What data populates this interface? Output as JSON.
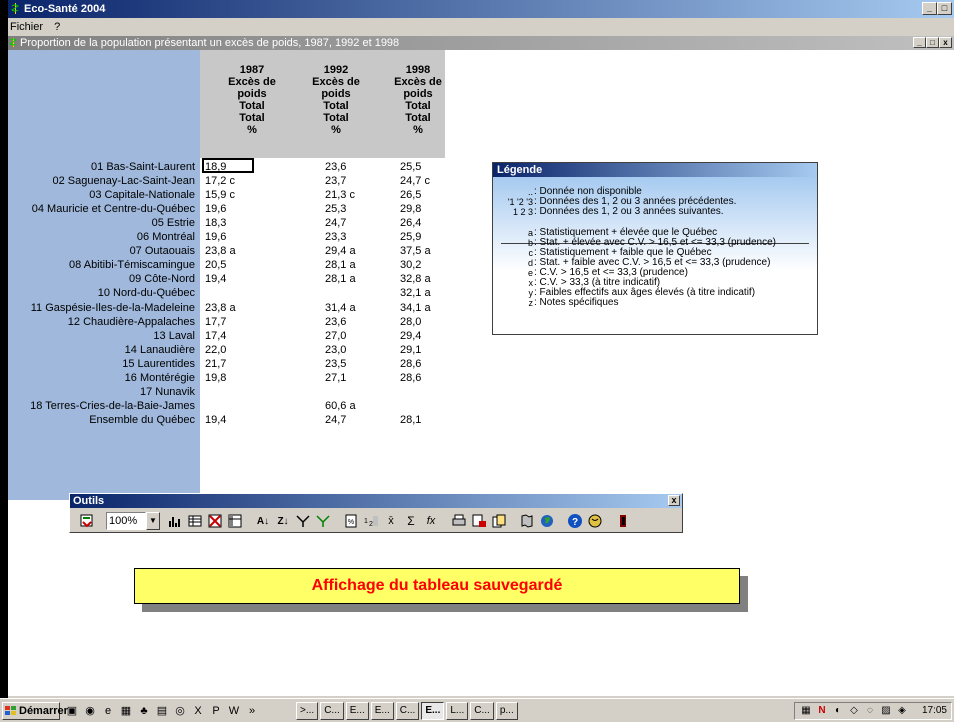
{
  "app": {
    "title": "Eco-Santé 2004",
    "menu": [
      "Fichier",
      "?"
    ],
    "window_buttons": [
      "_",
      "□",
      "x"
    ]
  },
  "child": {
    "title": "Proportion de la population présentant un excès de poids, 1987, 1992 et 1998",
    "window_buttons": [
      "_",
      "□",
      "x"
    ]
  },
  "table": {
    "columns": [
      {
        "lines": [
          "1987",
          "Excès de",
          "poids",
          "Total",
          "Total",
          "%"
        ]
      },
      {
        "lines": [
          "1992",
          "Excès de",
          "poids",
          "Total",
          "Total",
          "%"
        ]
      },
      {
        "lines": [
          "1998",
          "Excès de",
          "poids",
          "Total",
          "Total",
          "%"
        ]
      }
    ],
    "rows": [
      {
        "label": "01 Bas-Saint-Laurent",
        "values": [
          "18,9",
          "23,6",
          "25,5"
        ]
      },
      {
        "label": "02 Saguenay-Lac-Saint-Jean",
        "values": [
          "17,2 c",
          "23,7",
          "24,7 c"
        ]
      },
      {
        "label": "03 Capitale-Nationale",
        "values": [
          "15,9 c",
          "21,3 c",
          "26,5"
        ]
      },
      {
        "label": "04 Mauricie et Centre-du-Québec",
        "values": [
          "19,6",
          "25,3",
          "29,8"
        ]
      },
      {
        "label": "05 Estrie",
        "values": [
          "18,3",
          "24,7",
          "26,4"
        ]
      },
      {
        "label": "06 Montréal",
        "values": [
          "19,6",
          "23,3",
          "25,9"
        ]
      },
      {
        "label": "07 Outaouais",
        "values": [
          "23,8 a",
          "29,4 a",
          "37,5 a"
        ]
      },
      {
        "label": "08 Abitibi-Témiscamingue",
        "values": [
          "20,5",
          "28,1 a",
          "30,2"
        ]
      },
      {
        "label": "09 Côte-Nord",
        "values": [
          "19,4",
          "28,1 a",
          "32,8 a"
        ]
      },
      {
        "label": "10 Nord-du-Québec",
        "values": [
          "",
          "",
          "32,1 a"
        ]
      },
      {
        "label": "11 Gaspésie-Iles-de-la-Madeleine",
        "values": [
          "23,8 a",
          "31,4 a",
          "34,1 a"
        ]
      },
      {
        "label": "12 Chaudière-Appalaches",
        "values": [
          "17,7",
          "23,6",
          "28,0"
        ]
      },
      {
        "label": "13 Laval",
        "values": [
          "17,4",
          "27,0",
          "29,4"
        ]
      },
      {
        "label": "14 Lanaudière",
        "values": [
          "22,0",
          "23,0",
          "29,1"
        ]
      },
      {
        "label": "15 Laurentides",
        "values": [
          "21,7",
          "23,5",
          "28,6"
        ]
      },
      {
        "label": "16 Montérégie",
        "values": [
          "19,8",
          "27,1",
          "28,6"
        ]
      },
      {
        "label": "17 Nunavik",
        "values": [
          "",
          "",
          ""
        ]
      },
      {
        "label": "18 Terres-Cries-de-la-Baie-James",
        "values": [
          "",
          "60,6 a",
          ""
        ]
      },
      {
        "label": "Ensemble du Québec",
        "values": [
          "19,4",
          "24,7",
          "28,1"
        ]
      }
    ]
  },
  "legend": {
    "title": "Légende",
    "lines": [
      {
        "key": "..",
        "text": ": Donnée non disponible"
      },
      {
        "key": "'1 '2 '3",
        "text": ": Données des 1, 2 ou 3 années précédentes."
      },
      {
        "key": "1 2 3",
        "text": ": Données des 1, 2 ou 3 années suivantes."
      },
      {
        "key": "a",
        "text": ": Statistiquement + élevée que le Québec"
      },
      {
        "key": "b",
        "text": ": Stat. + élevée avec C.V. > 16,5 et <= 33,3 (prudence)"
      },
      {
        "key": "c",
        "text": ": Statistiquement + faible que le Québec"
      },
      {
        "key": "d",
        "text": ": Stat. + faible avec C.V. > 16,5 et <= 33,3 (prudence)"
      },
      {
        "key": "e",
        "text": ": C.V. > 16,5 et <= 33,3 (prudence)"
      },
      {
        "key": "x",
        "text": ": C.V. > 33,3 (à titre indicatif)"
      },
      {
        "key": "y",
        "text": ": Faibles effectifs aux âges élevés (à titre indicatif)"
      },
      {
        "key": "z",
        "text": ": Notes spécifiques"
      }
    ]
  },
  "toolbox": {
    "title": "Outils",
    "zoom": "100%",
    "close": "x",
    "tools": [
      "save-icon",
      "zoom",
      "chart-bars-icon",
      "table-grid-icon",
      "delete-grid-icon",
      "table-layout-icon",
      "sort-asc-icon",
      "sort-desc-icon",
      "filter-icon",
      "filter-alt-icon",
      "percent-icon",
      "decimals-icon",
      "mean-icon",
      "sum-icon",
      "function-icon",
      "print-icon",
      "export-icon",
      "copy-icon",
      "map-icon",
      "globe-icon",
      "help-icon",
      "web-help-icon",
      "exit-icon"
    ]
  },
  "banner": {
    "text": "Affichage du tableau sauvegardé"
  },
  "taskbar": {
    "start": "Démarrer",
    "buttons": [
      ">...",
      "C...",
      "E...",
      "E...",
      "C...",
      "E...",
      "L...",
      "C...",
      "p..."
    ],
    "clock": "17:05"
  },
  "colors": {
    "title_active": "#0a246a",
    "title_gradient_end": "#a6caf0",
    "row_header": "#9fb8db",
    "banner_bg": "#ffff66",
    "banner_text": "#ff0000"
  }
}
